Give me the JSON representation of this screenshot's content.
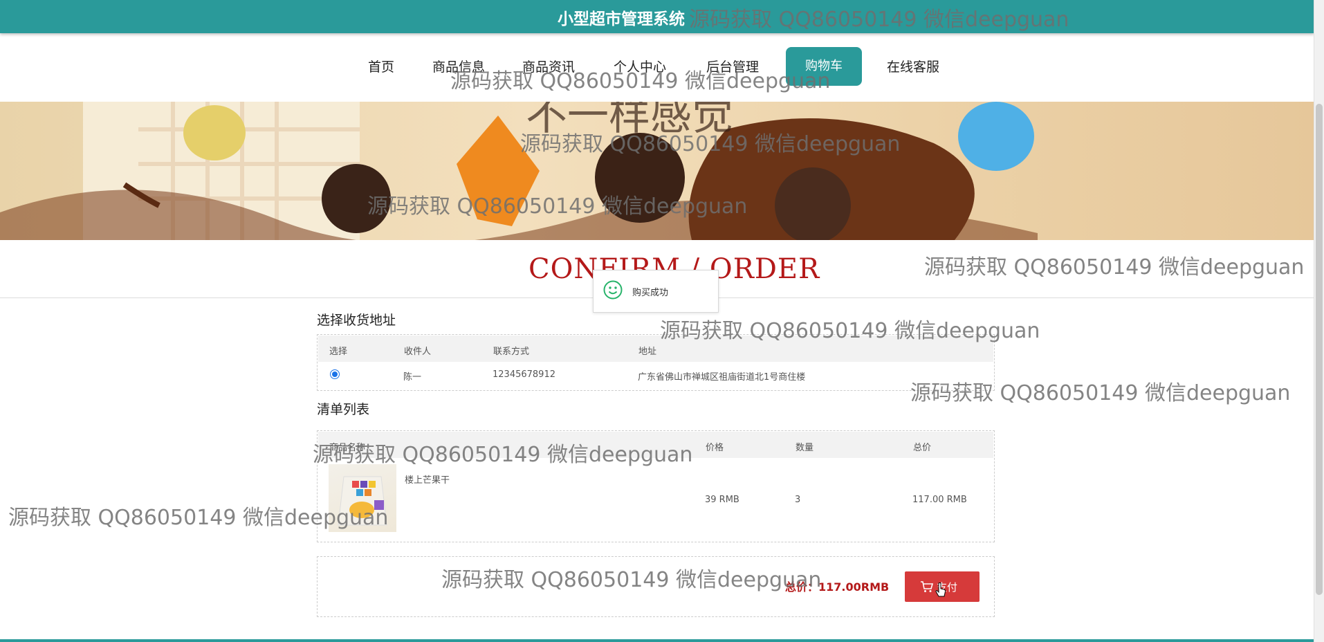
{
  "header": {
    "site_title": "小型超市管理系统"
  },
  "nav": {
    "items": [
      {
        "label": "首页"
      },
      {
        "label": "商品信息"
      },
      {
        "label": "商品资讯"
      },
      {
        "label": "个人中心"
      },
      {
        "label": "后台管理"
      },
      {
        "label": "购物车",
        "active": true
      },
      {
        "label": "在线客服"
      }
    ]
  },
  "banner": {
    "text": "不一样感觉"
  },
  "page": {
    "confirm_title": "CONFIRM / ORDER"
  },
  "toast": {
    "message": "购买成功",
    "icon": "smile-icon"
  },
  "address": {
    "section_title": "选择收货地址",
    "headers": {
      "select": "选择",
      "receiver": "收件人",
      "phone": "联系方式",
      "address": "地址"
    },
    "rows": [
      {
        "selected": true,
        "receiver": "陈一",
        "phone": "12345678912",
        "address": "广东省佛山市禅城区祖庙街道北1号商住楼"
      }
    ]
  },
  "order": {
    "section_title": "清单列表",
    "headers": {
      "product": "商品名称",
      "price": "价格",
      "qty": "数量",
      "total": "总价"
    },
    "items": [
      {
        "name": "楼上芒果干",
        "price": "39 RMB",
        "qty": "3",
        "total": "117.00 RMB"
      }
    ],
    "grand_total": "总价：117.00RMB",
    "pay_label": "支付"
  },
  "watermark": "源码获取 QQ86050149 微信deepguan",
  "colors": {
    "primary": "#2a9a9a",
    "accent_red": "#b41919",
    "pay_button": "#d63a3a"
  }
}
